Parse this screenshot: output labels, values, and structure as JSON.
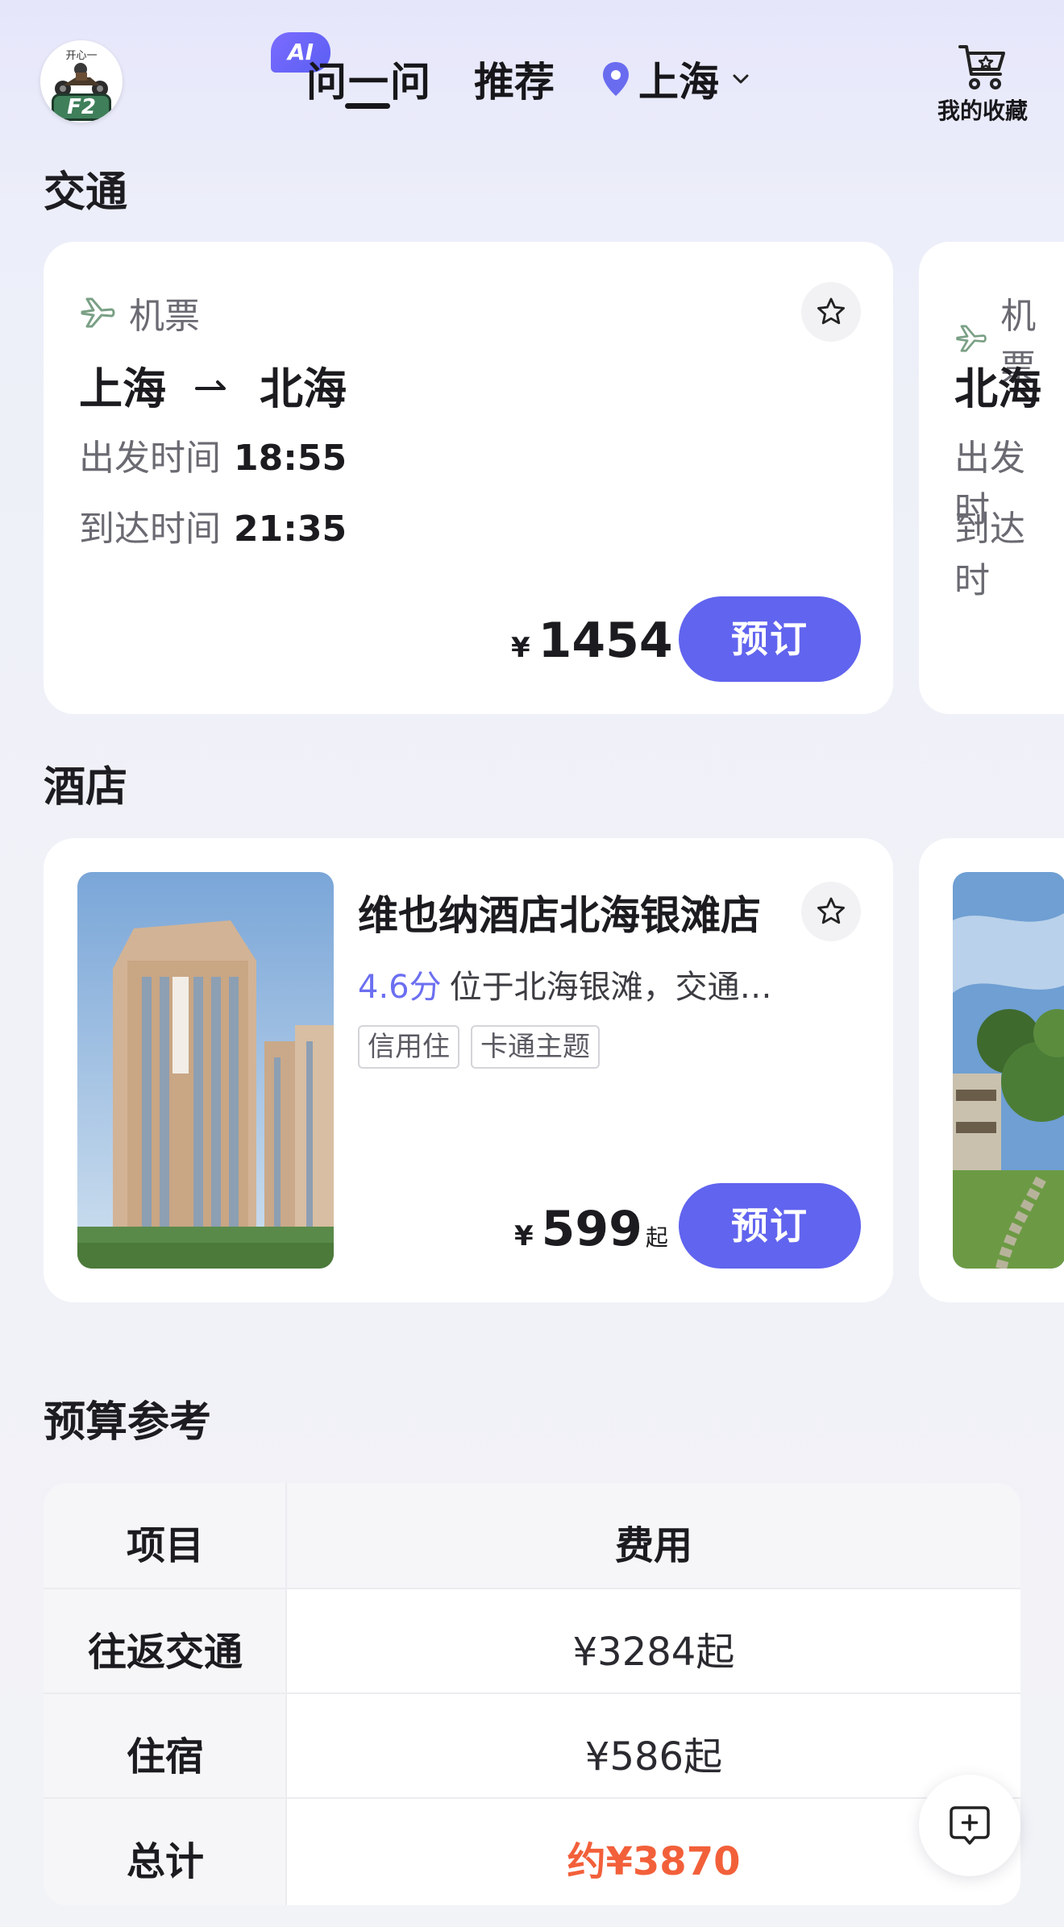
{
  "header": {
    "avatar_top_text": "开心一",
    "avatar_badge": "F2",
    "ai_badge": "AI",
    "nav_ask": "问一问",
    "nav_recommend": "推荐",
    "city": "上海",
    "favorites_label": "我的收藏"
  },
  "transport": {
    "title": "交通",
    "cards": [
      {
        "type": "机票",
        "from": "上海",
        "to": "北海",
        "depart_label": "出发时间",
        "depart_time": "18:55",
        "arrive_label": "到达时间",
        "arrive_time": "21:35",
        "currency": "¥",
        "price": "1454",
        "book_label": "预订"
      },
      {
        "type": "机票",
        "from": "北海",
        "depart_label": "出发时",
        "arrive_label": "到达时"
      }
    ]
  },
  "hotels": {
    "title": "酒店",
    "cards": [
      {
        "name": "维也纳酒店北海银滩店",
        "score": "4.6分",
        "description": "位于北海银滩，交通…",
        "tags": [
          "信用住",
          "卡通主题"
        ],
        "currency": "¥",
        "price": "599",
        "price_suffix": "起",
        "book_label": "预订"
      }
    ]
  },
  "budget": {
    "title": "预算参考",
    "headers": [
      "项目",
      "费用"
    ],
    "rows": [
      {
        "item": "往返交通",
        "cost": "¥3284起"
      },
      {
        "item": "住宿",
        "cost": "¥586起"
      },
      {
        "item": "总计",
        "cost": "约¥3870"
      }
    ]
  },
  "colors": {
    "accent": "#6164ee",
    "score": "#6b6ff0",
    "total_highlight": "#f2603a"
  },
  "icons": [
    "pin-icon",
    "chevron-down-icon",
    "cart-icon",
    "plane-icon",
    "star-icon",
    "arrow-right-icon",
    "add-chat-icon"
  ]
}
